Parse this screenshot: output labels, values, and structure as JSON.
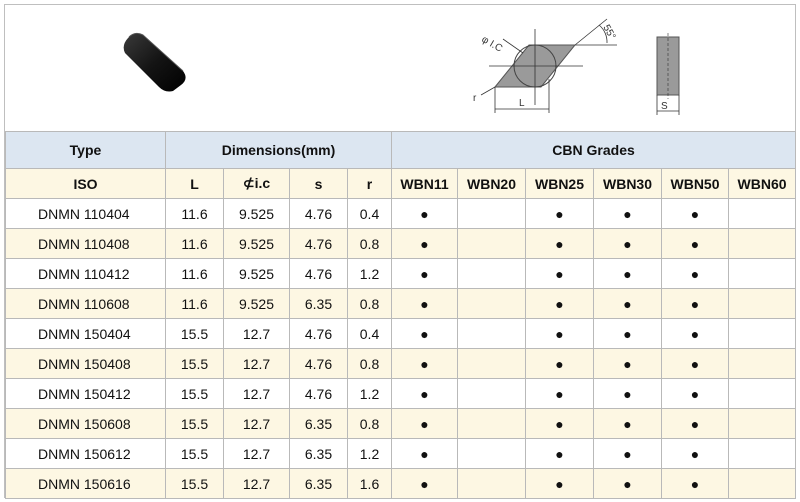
{
  "header": {
    "type_label": "Type",
    "dimensions_label": "Dimensions(mm)",
    "cbn_label": "CBN Grades"
  },
  "drawing": {
    "ic_label": "φ I.C",
    "angle_label": "55°",
    "l_label": "L",
    "r_label": "r",
    "s_label": "S"
  },
  "columns": {
    "iso": "ISO",
    "L": "L",
    "ic": "⊄i.c",
    "s": "s",
    "r": "r",
    "grades": [
      "WBN11",
      "WBN20",
      "WBN25",
      "WBN30",
      "WBN50",
      "WBN60"
    ]
  },
  "rows": [
    {
      "iso": "DNMN 110404",
      "L": "11.6",
      "ic": "9.525",
      "s": "4.76",
      "r": "0.4",
      "marks": [
        "●",
        "",
        "●",
        "●",
        "●",
        ""
      ]
    },
    {
      "iso": "DNMN 110408",
      "L": "11.6",
      "ic": "9.525",
      "s": "4.76",
      "r": "0.8",
      "marks": [
        "●",
        "",
        "●",
        "●",
        "●",
        ""
      ]
    },
    {
      "iso": "DNMN 110412",
      "L": "11.6",
      "ic": "9.525",
      "s": "4.76",
      "r": "1.2",
      "marks": [
        "●",
        "",
        "●",
        "●",
        "●",
        ""
      ]
    },
    {
      "iso": "DNMN 110608",
      "L": "11.6",
      "ic": "9.525",
      "s": "6.35",
      "r": "0.8",
      "marks": [
        "●",
        "",
        "●",
        "●",
        "●",
        ""
      ]
    },
    {
      "iso": "DNMN 150404",
      "L": "15.5",
      "ic": "12.7",
      "s": "4.76",
      "r": "0.4",
      "marks": [
        "●",
        "",
        "●",
        "●",
        "●",
        ""
      ]
    },
    {
      "iso": "DNMN 150408",
      "L": "15.5",
      "ic": "12.7",
      "s": "4.76",
      "r": "0.8",
      "marks": [
        "●",
        "",
        "●",
        "●",
        "●",
        ""
      ]
    },
    {
      "iso": "DNMN 150412",
      "L": "15.5",
      "ic": "12.7",
      "s": "4.76",
      "r": "1.2",
      "marks": [
        "●",
        "",
        "●",
        "●",
        "●",
        ""
      ]
    },
    {
      "iso": "DNMN 150608",
      "L": "15.5",
      "ic": "12.7",
      "s": "6.35",
      "r": "0.8",
      "marks": [
        "●",
        "",
        "●",
        "●",
        "●",
        ""
      ]
    },
    {
      "iso": "DNMN 150612",
      "L": "15.5",
      "ic": "12.7",
      "s": "6.35",
      "r": "1.2",
      "marks": [
        "●",
        "",
        "●",
        "●",
        "●",
        ""
      ]
    },
    {
      "iso": "DNMN 150616",
      "L": "15.5",
      "ic": "12.7",
      "s": "6.35",
      "r": "1.6",
      "marks": [
        "●",
        "",
        "●",
        "●",
        "●",
        ""
      ]
    }
  ],
  "colors": {
    "group_header_bg": "#dce6f1",
    "alt_row_bg": "#fdf7e3",
    "border": "#b9b9b9",
    "insert_color": "#141414",
    "drawing_fill": "#9a9a9a"
  }
}
